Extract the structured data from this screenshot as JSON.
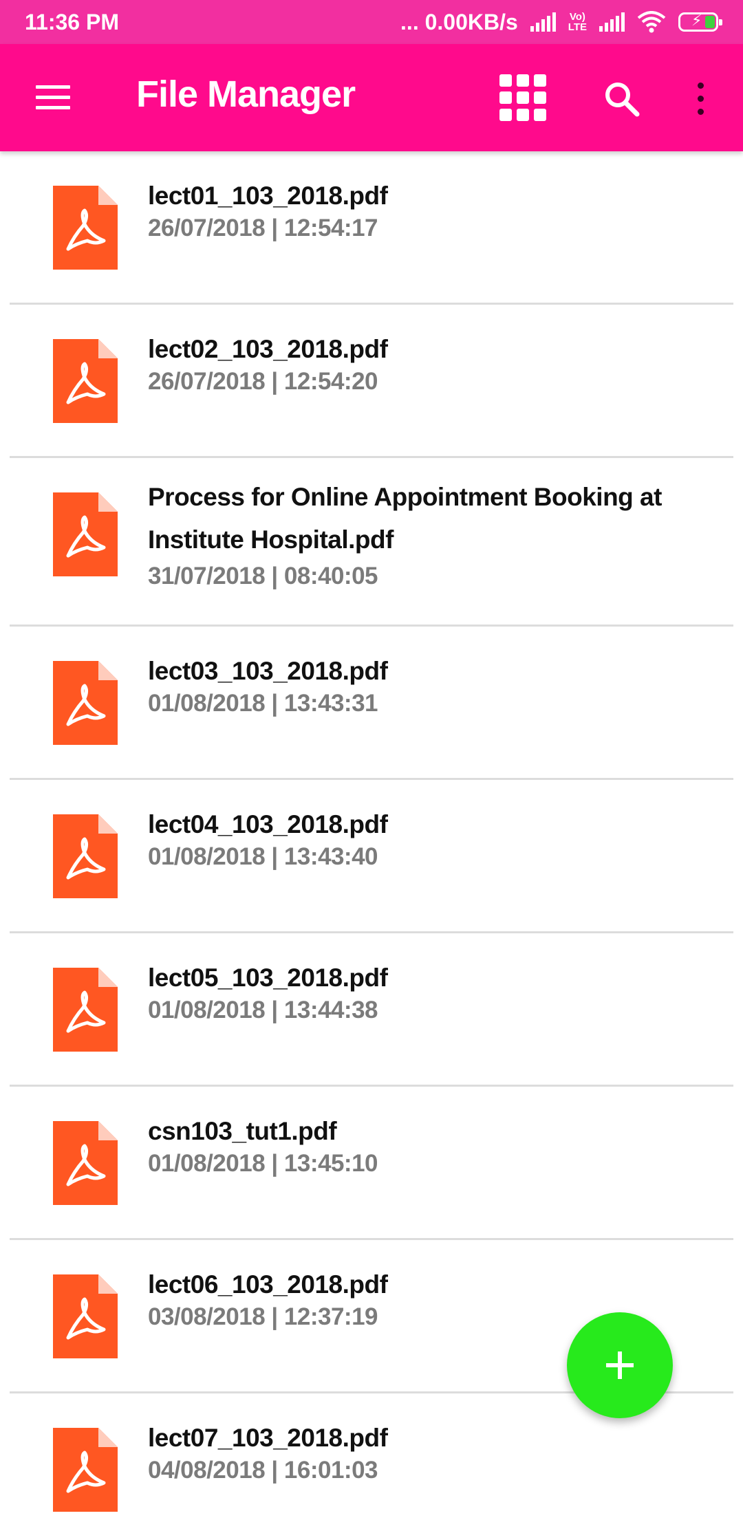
{
  "status_bar": {
    "time": "11:36 PM",
    "network_speed": "... 0.00KB/s",
    "volte_line1": "Vo)",
    "volte_line2": "LTE"
  },
  "app_bar": {
    "title": "File Manager",
    "icons": [
      "menu-icon",
      "grid-view-icon",
      "search-icon",
      "more-vert-icon"
    ]
  },
  "files": [
    {
      "name": "lect01_103_2018.pdf",
      "date": "26/07/2018 | 12:54:17"
    },
    {
      "name": "lect02_103_2018.pdf",
      "date": "26/07/2018 | 12:54:20"
    },
    {
      "name": "Process for Online Appointment Booking at Institute Hospital.pdf",
      "date": "31/07/2018 | 08:40:05"
    },
    {
      "name": "lect03_103_2018.pdf",
      "date": "01/08/2018 | 13:43:31"
    },
    {
      "name": "lect04_103_2018.pdf",
      "date": "01/08/2018 | 13:43:40"
    },
    {
      "name": "lect05_103_2018.pdf",
      "date": "01/08/2018 | 13:44:38"
    },
    {
      "name": "csn103_tut1.pdf",
      "date": "01/08/2018 | 13:45:10"
    },
    {
      "name": "lect06_103_2018.pdf",
      "date": "03/08/2018 | 12:37:19"
    },
    {
      "name": "lect07_103_2018.pdf",
      "date": "04/08/2018 | 16:01:03"
    }
  ],
  "fab": {
    "icon": "plus-icon"
  },
  "colors": {
    "status_bar": "#f22fa0",
    "app_bar": "#ff0a8c",
    "pdf_icon": "#ff5722",
    "fab": "#27ea1c",
    "date_text": "#7b7b7b"
  }
}
